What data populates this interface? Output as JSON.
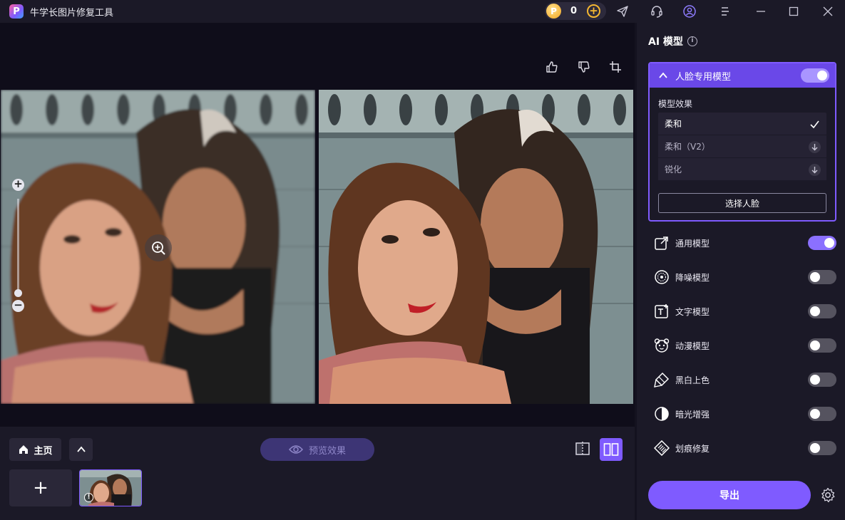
{
  "app": {
    "title": "牛学长图片修复工具",
    "logo_letter": "P"
  },
  "titlebar": {
    "coin_symbol": "P",
    "coin_count": "0",
    "add_symbol": "+",
    "icons": [
      "send-icon",
      "headset-icon",
      "user-icon",
      "menu-icon",
      "minimize-icon",
      "maximize-icon",
      "close-icon"
    ]
  },
  "canvas": {
    "tools": [
      "thumbs-up-icon",
      "thumbs-down-icon",
      "crop-icon"
    ],
    "zoom_in": "+",
    "zoom_out": "−"
  },
  "bottom": {
    "home_label": "主页",
    "preview_label": "预览效果",
    "add_symbol": "+",
    "thumb_info": "!"
  },
  "panel": {
    "title": "AI 模型",
    "face_model": {
      "label": "人脸专用模型",
      "enabled": true,
      "effect_heading": "模型效果",
      "options": [
        {
          "label": "柔和",
          "state": "selected"
        },
        {
          "label": "柔和（V2）",
          "state": "download"
        },
        {
          "label": "锐化",
          "state": "download"
        }
      ],
      "select_face_label": "选择人脸"
    },
    "models": [
      {
        "label": "通用模型",
        "icon": "general-model-icon",
        "enabled": true
      },
      {
        "label": "降噪模型",
        "icon": "denoise-model-icon",
        "enabled": false
      },
      {
        "label": "文字模型",
        "icon": "text-model-icon",
        "enabled": false
      },
      {
        "label": "动漫模型",
        "icon": "anime-model-icon",
        "enabled": false
      },
      {
        "label": "黑白上色",
        "icon": "colorize-icon",
        "enabled": false
      },
      {
        "label": "暗光增强",
        "icon": "low-light-icon",
        "enabled": false
      },
      {
        "label": "划痕修复",
        "icon": "scratch-repair-icon",
        "enabled": false
      }
    ],
    "export_label": "导出"
  },
  "colors": {
    "accent": "#7f5bff",
    "panel_bg": "#1b1927",
    "canvas_bg": "#0f0d1a",
    "coin": "#f5b731"
  }
}
